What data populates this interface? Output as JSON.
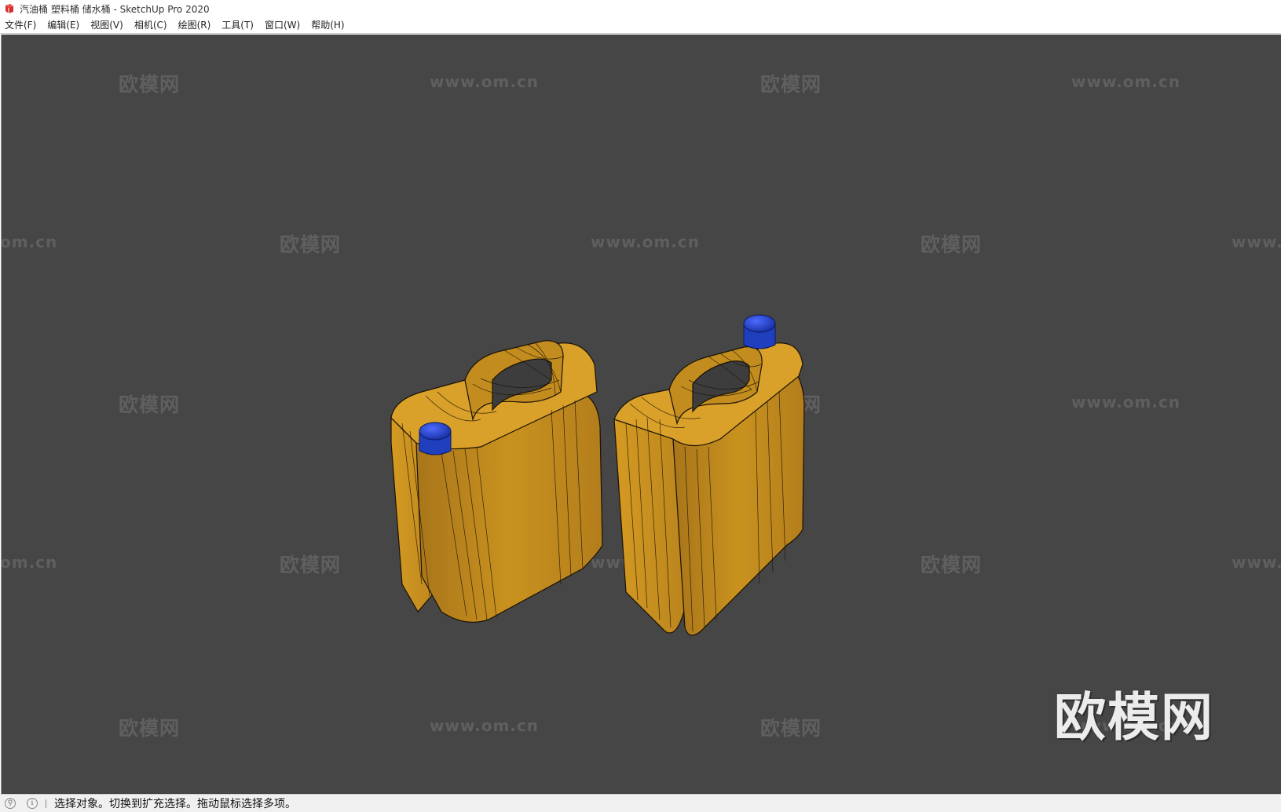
{
  "window": {
    "title": "汽油桶 塑料桶 储水桶 - SketchUp Pro 2020",
    "app_icon": "sketchup-logo-icon",
    "accent_color": "#d32f2f"
  },
  "menu": [
    {
      "label": "文件(F)"
    },
    {
      "label": "编辑(E)"
    },
    {
      "label": "视图(V)"
    },
    {
      "label": "相机(C)"
    },
    {
      "label": "绘图(R)"
    },
    {
      "label": "工具(T)"
    },
    {
      "label": "窗口(W)"
    },
    {
      "label": "帮助(H)"
    }
  ],
  "viewport": {
    "background": "#464646",
    "model_colors": {
      "canister": "#c9921f",
      "cap": "#1f3fbf"
    },
    "watermark_logo_text": "欧模网",
    "watermark_url_text": "www.om.cn",
    "watermark_url_left_partial": "om.cn",
    "watermark_url_right_partial": "www.",
    "big_watermark": "欧模网"
  },
  "statusbar": {
    "geo_icon": "geolocation-icon",
    "info_icon": "info-icon",
    "message": "选择对象。切换到扩充选择。拖动鼠标选择多项。"
  }
}
